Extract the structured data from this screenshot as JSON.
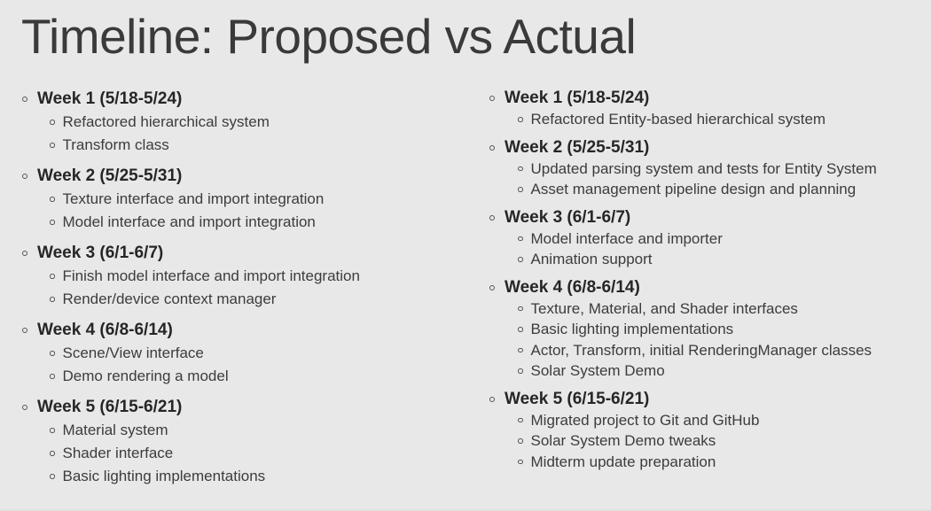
{
  "slide": {
    "title": "Timeline: Proposed vs Actual",
    "background_color": "#e8e8e8",
    "title_color": "#3a3a3a",
    "body_color": "#3c3c3c"
  },
  "columns": [
    {
      "name": "proposed",
      "groups": [
        {
          "week": "Week 1 (5/18-5/24)",
          "items": [
            "Refactored hierarchical system",
            "Transform class"
          ]
        },
        {
          "week": "Week 2 (5/25-5/31)",
          "items": [
            "Texture interface and import integration",
            "Model interface and import integration"
          ]
        },
        {
          "week": "Week 3 (6/1-6/7)",
          "items": [
            "Finish model interface and import integration",
            "Render/device context manager"
          ]
        },
        {
          "week": "Week 4 (6/8-6/14)",
          "items": [
            "Scene/View interface",
            "Demo rendering a model"
          ]
        },
        {
          "week": "Week 5 (6/15-6/21)",
          "items": [
            "Material system",
            "Shader interface",
            "Basic lighting implementations"
          ]
        }
      ]
    },
    {
      "name": "actual",
      "groups": [
        {
          "week": "Week 1 (5/18-5/24)",
          "items": [
            "Refactored Entity-based hierarchical system"
          ]
        },
        {
          "week": "Week 2 (5/25-5/31)",
          "items": [
            "Updated parsing system and tests for Entity System",
            "Asset management pipeline design and planning"
          ]
        },
        {
          "week": "Week 3 (6/1-6/7)",
          "items": [
            "Model interface and importer",
            "Animation support"
          ]
        },
        {
          "week": "Week 4 (6/8-6/14)",
          "items": [
            "Texture, Material, and Shader interfaces",
            "Basic lighting implementations",
            "Actor, Transform, initial RenderingManager classes",
            "Solar System Demo"
          ]
        },
        {
          "week": "Week 5 (6/15-6/21)",
          "items": [
            "Migrated project to Git and GitHub",
            "Solar System Demo tweaks",
            "Midterm update preparation"
          ]
        }
      ]
    }
  ]
}
